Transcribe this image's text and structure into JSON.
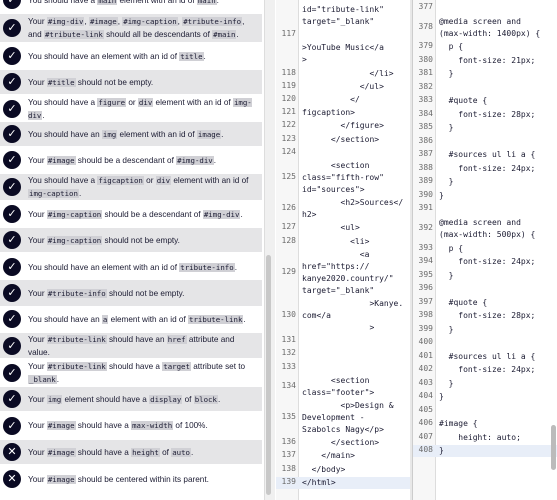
{
  "tests": [
    {
      "pass": true,
      "text": "You should have a main element with an id of main."
    },
    {
      "pass": true,
      "text": "Your #img-div, #image, #img-caption, #tribute-info, and #tribute-link should all be descendants of #main."
    },
    {
      "pass": true,
      "text": "You should have an element with an id of title."
    },
    {
      "pass": true,
      "text": "Your #title should not be empty."
    },
    {
      "pass": true,
      "text": "You should have a figure or div element with an id of img-div."
    },
    {
      "pass": true,
      "text": "You should have an img element with an id of image."
    },
    {
      "pass": true,
      "text": "Your #image should be a descendant of #img-div."
    },
    {
      "pass": true,
      "text": "You should have a figcaption or div element with an id of img-caption."
    },
    {
      "pass": true,
      "text": "Your #img-caption should be a descendant of #img-div."
    },
    {
      "pass": true,
      "text": "Your #img-caption should not be empty."
    },
    {
      "pass": true,
      "text": "You should have an element with an id of tribute-info."
    },
    {
      "pass": true,
      "text": "Your #tribute-info should not be empty."
    },
    {
      "pass": true,
      "text": "You should have an a element with an id of tribute-link."
    },
    {
      "pass": true,
      "text": "Your #tribute-link should have an href attribute and value."
    },
    {
      "pass": true,
      "text": "Your #tribute-link should have a target attribute set to _blank."
    },
    {
      "pass": true,
      "text": "Your img element should have a display of block."
    },
    {
      "pass": true,
      "text": "Your #image should have a max-width of 100%."
    },
    {
      "pass": false,
      "text": "Your #image should have a height of auto."
    },
    {
      "pass": false,
      "text": "Your #image should be centered within its parent."
    }
  ],
  "html_editor": {
    "lines": [
      {
        "n": "",
        "t": "id=\"tribute-link\"\ntarget=\"_blank\""
      },
      {
        "n": "117",
        "t": ""
      },
      {
        "n": "",
        "t": ">YouTube Music</a\n>"
      },
      {
        "n": "118",
        "t": "              </li>"
      },
      {
        "n": "119",
        "t": "            </ul>"
      },
      {
        "n": "120",
        "t": "          </"
      },
      {
        "n": "121",
        "t": "figcaption>"
      },
      {
        "n": "122",
        "t": "        </figure>"
      },
      {
        "n": "123",
        "t": "      </section>"
      },
      {
        "n": "124",
        "t": ""
      },
      {
        "n": "125",
        "t": "      <section\nclass=\"fifth-row\"\nid=\"sources\">"
      },
      {
        "n": "126",
        "t": "        <h2>Sources</\nh2>"
      },
      {
        "n": "127",
        "t": "        <ul>"
      },
      {
        "n": "128",
        "t": "          <li>"
      },
      {
        "n": "129",
        "t": "            <a\nhref=\"https://\nkanye2020.country/\"\ntarget=\"_blank\""
      },
      {
        "n": "130",
        "t": "              >Kanye.\ncom</a\n              >"
      },
      {
        "n": "131",
        "t": ""
      },
      {
        "n": "132",
        "t": ""
      },
      {
        "n": "133",
        "t": ""
      },
      {
        "n": "134",
        "t": "      <section\nclass=\"footer\">"
      },
      {
        "n": "135",
        "t": "        <p>Design &\nDevelopment -\nSzabolcs Nagy</p>"
      },
      {
        "n": "136",
        "t": "      </section>"
      },
      {
        "n": "137",
        "t": "    </main>"
      },
      {
        "n": "138",
        "t": "  </body>"
      },
      {
        "n": "139",
        "t": "</html>"
      }
    ]
  },
  "css_editor": {
    "lines": [
      {
        "n": "377",
        "t": ""
      },
      {
        "n": "378",
        "t": "@media screen and\n(max-width: 1400px) {"
      },
      {
        "n": "379",
        "t": "  p {"
      },
      {
        "n": "380",
        "t": "    font-size: 21px;"
      },
      {
        "n": "381",
        "t": "  }"
      },
      {
        "n": "382",
        "t": ""
      },
      {
        "n": "383",
        "t": "  #quote {"
      },
      {
        "n": "384",
        "t": "    font-size: 28px;"
      },
      {
        "n": "385",
        "t": "  }"
      },
      {
        "n": "386",
        "t": ""
      },
      {
        "n": "387",
        "t": "  #sources ul li a {"
      },
      {
        "n": "388",
        "t": "    font-size: 24px;"
      },
      {
        "n": "389",
        "t": "  }"
      },
      {
        "n": "390",
        "t": "}"
      },
      {
        "n": "391",
        "t": ""
      },
      {
        "n": "392",
        "t": "@media screen and\n(max-width: 500px) {"
      },
      {
        "n": "393",
        "t": "  p {"
      },
      {
        "n": "394",
        "t": "    font-size: 24px;"
      },
      {
        "n": "395",
        "t": "  }"
      },
      {
        "n": "396",
        "t": ""
      },
      {
        "n": "397",
        "t": "  #quote {"
      },
      {
        "n": "398",
        "t": "    font-size: 28px;"
      },
      {
        "n": "399",
        "t": "  }"
      },
      {
        "n": "400",
        "t": ""
      },
      {
        "n": "401",
        "t": "  #sources ul li a {"
      },
      {
        "n": "402",
        "t": "    font-size: 24px;"
      },
      {
        "n": "403",
        "t": "  }"
      },
      {
        "n": "404",
        "t": "}"
      },
      {
        "n": "405",
        "t": ""
      },
      {
        "n": "406",
        "t": "#image {"
      },
      {
        "n": "407",
        "t": "    height: auto;"
      },
      {
        "n": "408",
        "t": "}"
      }
    ]
  }
}
